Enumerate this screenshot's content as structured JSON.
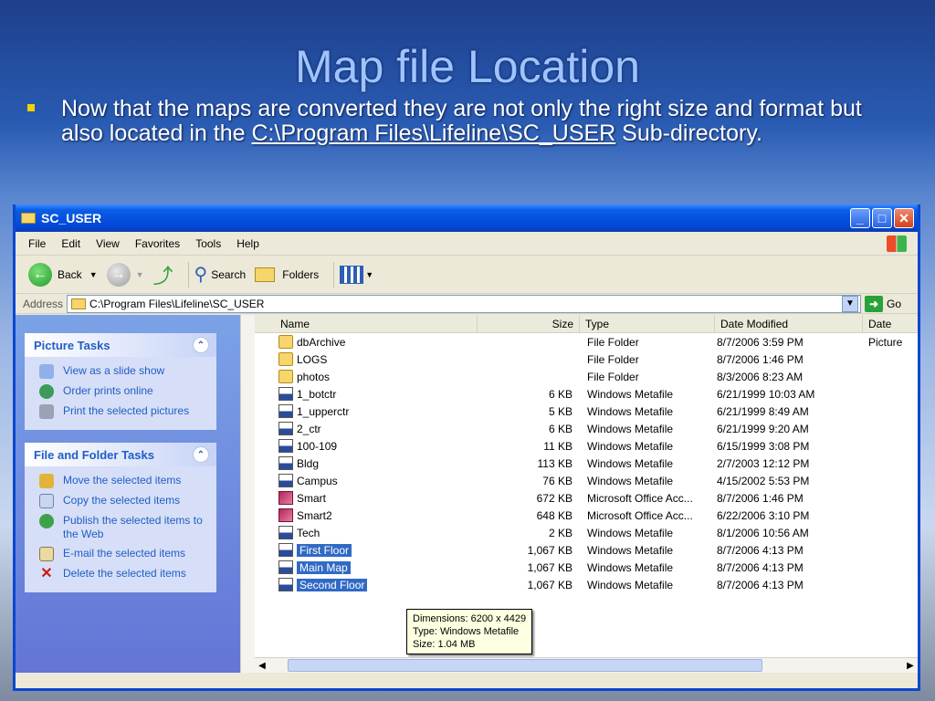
{
  "slide": {
    "title": "Map file Location",
    "bullet_text": "Now that the maps are converted they are not only the right size and format  but also located in the ",
    "bullet_path": "C:\\Program Files\\Lifeline\\SC_USER",
    "bullet_tail": " Sub-directory."
  },
  "window": {
    "title": "SC_USER",
    "controls": {
      "minimize": "_",
      "maximize": "□",
      "close": "✕"
    }
  },
  "menu": [
    "File",
    "Edit",
    "View",
    "Favorites",
    "Tools",
    "Help"
  ],
  "toolbar": {
    "back": "Back",
    "search": "Search",
    "folders": "Folders"
  },
  "address": {
    "label": "Address",
    "value": "C:\\Program Files\\Lifeline\\SC_USER",
    "go": "Go"
  },
  "tasks": {
    "picture": {
      "title": "Picture Tasks",
      "items": [
        "View as a slide show",
        "Order prints online",
        "Print the selected pictures"
      ]
    },
    "file_folder": {
      "title": "File and Folder Tasks",
      "items": [
        "Move the selected items",
        "Copy the selected items",
        "Publish the selected items to the Web",
        "E-mail the selected items",
        "Delete the selected items"
      ]
    }
  },
  "columns": {
    "name": "Name",
    "size": "Size",
    "type": "Type",
    "date_modified": "Date Modified",
    "date_picture": "Date Picture"
  },
  "files": [
    {
      "name": "dbArchive",
      "size": "",
      "type": "File Folder",
      "date": "8/7/2006 3:59 PM",
      "icon": "folder"
    },
    {
      "name": "LOGS",
      "size": "",
      "type": "File Folder",
      "date": "8/7/2006 1:46 PM",
      "icon": "folder"
    },
    {
      "name": "photos",
      "size": "",
      "type": "File Folder",
      "date": "8/3/2006 8:23 AM",
      "icon": "folder"
    },
    {
      "name": "1_botctr",
      "size": "6 KB",
      "type": "Windows Metafile",
      "date": "6/21/1999 10:03 AM",
      "icon": "wmf"
    },
    {
      "name": "1_upperctr",
      "size": "5 KB",
      "type": "Windows Metafile",
      "date": "6/21/1999 8:49 AM",
      "icon": "wmf"
    },
    {
      "name": "2_ctr",
      "size": "6 KB",
      "type": "Windows Metafile",
      "date": "6/21/1999 9:20 AM",
      "icon": "wmf"
    },
    {
      "name": "100-109",
      "size": "11 KB",
      "type": "Windows Metafile",
      "date": "6/15/1999 3:08 PM",
      "icon": "wmf"
    },
    {
      "name": "Bldg",
      "size": "113 KB",
      "type": "Windows Metafile",
      "date": "2/7/2003 12:12 PM",
      "icon": "wmf"
    },
    {
      "name": "Campus",
      "size": "76 KB",
      "type": "Windows Metafile",
      "date": "4/15/2002 5:53 PM",
      "icon": "wmf"
    },
    {
      "name": "Smart",
      "size": "672 KB",
      "type": "Microsoft Office Acc...",
      "date": "8/7/2006 1:46 PM",
      "icon": "mdb"
    },
    {
      "name": "Smart2",
      "size": "648 KB",
      "type": "Microsoft Office Acc...",
      "date": "6/22/2006 3:10 PM",
      "icon": "mdb"
    },
    {
      "name": "Tech",
      "size": "2 KB",
      "type": "Windows Metafile",
      "date": "8/1/2006 10:56 AM",
      "icon": "wmf"
    },
    {
      "name": "First Floor",
      "size": "1,067 KB",
      "type": "Windows Metafile",
      "date": "8/7/2006 4:13 PM",
      "icon": "wmf",
      "selected": true
    },
    {
      "name": "Main Map",
      "size": "1,067 KB",
      "type": "Windows Metafile",
      "date": "8/7/2006 4:13 PM",
      "icon": "wmf",
      "selected": true
    },
    {
      "name": "Second Floor",
      "size": "1,067 KB",
      "type": "Windows Metafile",
      "date": "8/7/2006 4:13 PM",
      "icon": "wmf",
      "selected": true
    }
  ],
  "tooltip": [
    "Dimensions: 6200 x 4429",
    "Type: Windows Metafile",
    "Size: 1.04 MB"
  ]
}
